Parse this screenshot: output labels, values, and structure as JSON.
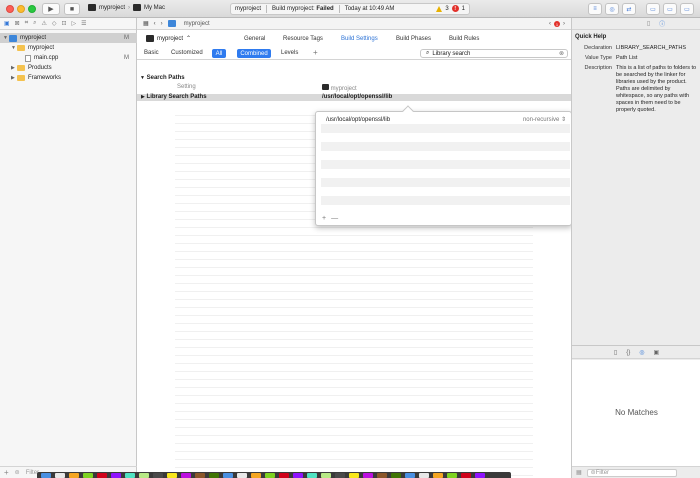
{
  "titlebar": {
    "scheme_target": "myproject",
    "scheme_device": "My Mac",
    "activity_project": "myproject",
    "activity_status_prefix": "Build myproject: ",
    "activity_status": "Failed",
    "activity_time": "Today at 10:49 AM",
    "warning_count": "3",
    "error_count": "1"
  },
  "navigator": {
    "items": [
      {
        "label": "myproject",
        "badge": "M"
      },
      {
        "label": "myproject",
        "badge": ""
      },
      {
        "label": "main.cpp",
        "badge": "M"
      },
      {
        "label": "Products",
        "badge": ""
      },
      {
        "label": "Frameworks",
        "badge": ""
      }
    ],
    "filter_placeholder": "Filter"
  },
  "editor": {
    "breadcrumb": "myproject",
    "target": "myproject",
    "tabs": [
      "General",
      "Resource Tags",
      "Build Settings",
      "Build Phases",
      "Build Rules"
    ],
    "active_tab": "Build Settings",
    "filters": {
      "basic": "Basic",
      "customized": "Customized",
      "all": "All",
      "combined": "Combined",
      "levels": "Levels",
      "add": "+"
    },
    "search_value": "Library search",
    "section": "Search Paths",
    "col_setting": "Setting",
    "col_target": "myproject",
    "row_name": "Library Search Paths",
    "row_value": "/usr/local/opt/openssl/lib",
    "popover": {
      "path": "/usr/local/opt/openssl/lib",
      "recursion": "non-recursive",
      "add": "+",
      "remove": "—"
    }
  },
  "inspector": {
    "quick_help_title": "Quick Help",
    "declaration_label": "Declaration",
    "declaration_value": "LIBRARY_SEARCH_PATHS",
    "value_type_label": "Value Type",
    "value_type_value": "Path List",
    "description_label": "Description",
    "description_value": "This is a list of paths to folders to be searched by the linker for libraries used by the product. Paths are delimited by whitespace, so any paths with spaces in them need to be properly quoted.",
    "no_matches": "No Matches",
    "filter_placeholder": "Filter"
  },
  "colors": {
    "accent": "#2f7bef",
    "error": "#e2312b",
    "warning": "#e8b100"
  }
}
